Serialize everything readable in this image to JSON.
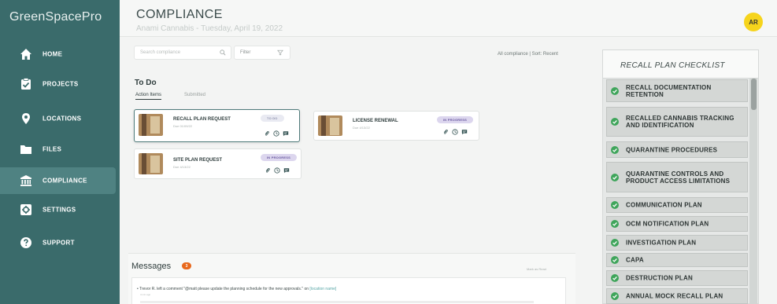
{
  "app": {
    "logo": "GreenSpacePro"
  },
  "sidebar": {
    "items": [
      {
        "label": "HOME",
        "icon": "home-icon"
      },
      {
        "label": "PROJECTS",
        "icon": "clipboard-check-icon"
      },
      {
        "label": "LOCATIONS",
        "icon": "map-pin-icon"
      },
      {
        "label": "FILES",
        "icon": "folder-icon"
      },
      {
        "label": "COMPLIANCE",
        "icon": "bank-icon",
        "active": true
      },
      {
        "label": "SETTINGS",
        "icon": "gear-icon"
      },
      {
        "label": "SUPPORT",
        "icon": "help-circle-icon"
      }
    ]
  },
  "header": {
    "title": "COMPLIANCE",
    "subtitle": "Anami Cannabis - Tuesday, April 19, 2022",
    "avatar_initials": "AR"
  },
  "toolbar": {
    "search_placeholder": "Search compliance",
    "filter_label": "Filter",
    "sort_label": "All compliance | Sort: Recent"
  },
  "todo": {
    "title": "To Do",
    "tabs": [
      "Action Items",
      "Submitted"
    ],
    "cards": [
      {
        "title": "RECALL PLAN REQUEST",
        "due": "Due 01/09/22",
        "status": "TO DO"
      },
      {
        "title": "LICENSE RENEWAL",
        "due": "Due 4/13/22",
        "status": "IN PROGRESS"
      },
      {
        "title": "SITE PLAN REQUEST",
        "due": "Due 4/13/22",
        "status": "IN PROGRESS"
      }
    ]
  },
  "messages": {
    "title": "Messages",
    "count": "3",
    "mark_read": "Mark as Read",
    "items": [
      {
        "text": "Trevor R. left a comment \"@matt please update the planning schedule for the new approvals.\" on ",
        "link": "[location name]",
        "time": "4 min ago"
      }
    ]
  },
  "checklist": {
    "title": "RECALL PLAN CHECKLIST",
    "items": [
      "RECALL DOCUMENTATION RETENTION",
      "RECALLED CANNABIS TRACKING AND IDENTIFICATION",
      "QUARANTINE PROCEDURES",
      "QUARANTINE CONTROLS AND PRODUCT ACCESS LIMITATIONS",
      "COMMUNICATION PLAN",
      "OCM NOTIFICATION PLAN",
      "INVESTIGATION PLAN",
      "CAPA",
      "DESTRUCTION PLAN",
      "ANNUAL MOCK RECALL PLAN"
    ]
  },
  "colors": {
    "sidebar": "#3a6b6b",
    "sidebar_active": "#4f8282",
    "avatar": "#f6d41c",
    "check": "#3fa55b",
    "badge_orange": "#e8681c"
  }
}
